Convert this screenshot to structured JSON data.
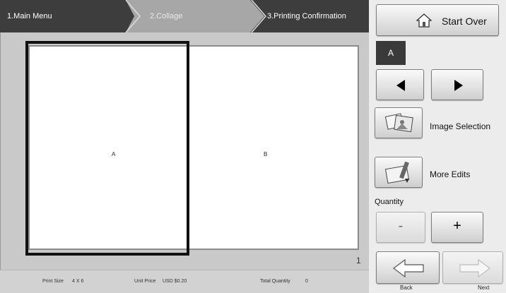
{
  "steps": {
    "step1": "1.Main Menu",
    "step2": "2.Collage",
    "step3": "3.Printing Confirmation"
  },
  "canvas": {
    "panel_a": "A",
    "panel_b": "B",
    "page_number": "1"
  },
  "footer": {
    "print_size_label": "Print Size",
    "print_size_value": "4 X 6",
    "unit_price_label": "Unit Price",
    "unit_price_value": "USD $0.20",
    "total_quantity_label": "Total Quantity",
    "total_quantity_value": "0"
  },
  "sidebar": {
    "start_over": "Start Over",
    "selected_panel": "A",
    "image_selection": "Image Selection",
    "more_edits": "More Edits",
    "quantity_label": "Quantity",
    "minus": "-",
    "plus": "+",
    "back": "Back",
    "next": "Next"
  },
  "icons": {
    "home": "home-icon",
    "prev": "arrow-left-icon",
    "next_panel": "arrow-right-icon",
    "image_selection": "photos-icon",
    "more_edits": "edit-tools-icon",
    "back": "back-arrow-icon",
    "next": "next-arrow-icon"
  },
  "colors": {
    "header_bg": "#3d3d3d",
    "selection_border": "#111111",
    "panel_bg": "#ececec"
  }
}
